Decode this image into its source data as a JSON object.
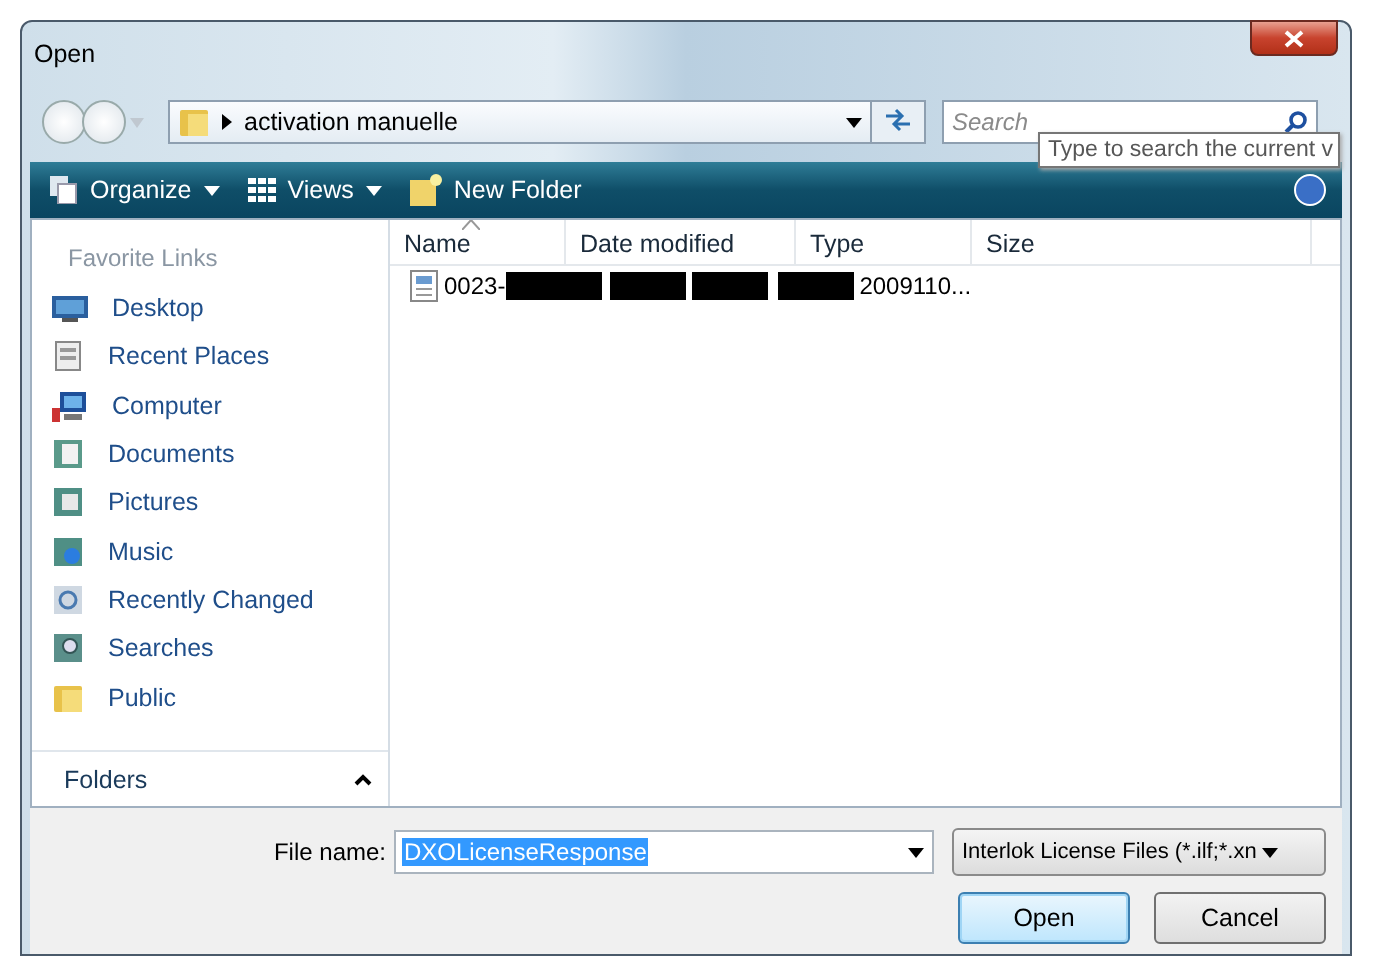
{
  "window": {
    "title": "Open"
  },
  "nav": {
    "path": "activation manuelle",
    "search_placeholder": "Search"
  },
  "tooltip": "Type to search the current v",
  "toolbar": [
    {
      "kind": "organize",
      "label": "Organize"
    },
    {
      "kind": "views",
      "label": "Views"
    },
    {
      "kind": "newfolder",
      "label": "New Folder"
    }
  ],
  "sidebar": {
    "heading": "Favorite Links",
    "items": [
      {
        "kind": "desktop",
        "label": "Desktop"
      },
      {
        "kind": "recent",
        "label": "Recent Places"
      },
      {
        "kind": "computer",
        "label": "Computer"
      },
      {
        "kind": "documents",
        "label": "Documents"
      },
      {
        "kind": "pictures",
        "label": "Pictures"
      },
      {
        "kind": "music",
        "label": "Music"
      },
      {
        "kind": "changed",
        "label": "Recently Changed"
      },
      {
        "kind": "searches",
        "label": "Searches"
      },
      {
        "kind": "public",
        "label": "Public"
      }
    ],
    "folders": "Folders"
  },
  "columns": [
    {
      "label": "Name",
      "sorted": true
    },
    {
      "label": "Date modified",
      "sorted": false
    },
    {
      "label": "Type",
      "sorted": false
    },
    {
      "label": "Size",
      "sorted": false
    }
  ],
  "files": [
    {
      "name": "0023-",
      "type": "2009110...",
      "redacted": true
    }
  ],
  "filename": {
    "label": "File name:",
    "value": "DXOLicenseResponse"
  },
  "filetype": "Interlok License Files (*.ilf;*.xn",
  "buttons": [
    {
      "label": "Open",
      "default": true
    },
    {
      "label": "Cancel",
      "default": false
    }
  ]
}
